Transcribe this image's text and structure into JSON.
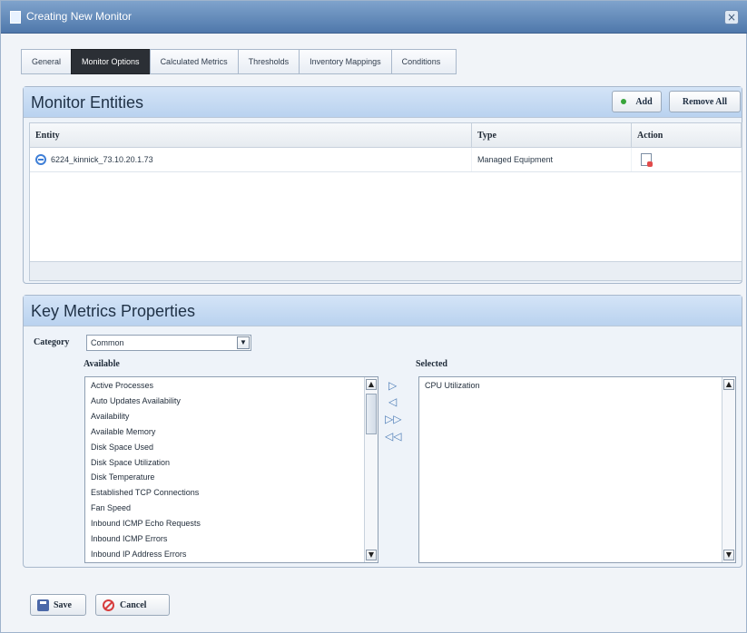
{
  "window": {
    "title": "Creating New Monitor",
    "close_glyph": "×"
  },
  "tabs": [
    "General",
    "Monitor Options",
    "Calculated Metrics",
    "Thresholds",
    "Inventory Mappings",
    "Conditions"
  ],
  "monitor_entities": {
    "title": "Monitor Entities",
    "add_label": "Add",
    "remove_all_label": "Remove All",
    "columns": [
      "Entity",
      "Type",
      "Action"
    ],
    "rows": [
      {
        "entity": "6224_kinnick_73.10.20.1.73",
        "type": "Managed Equipment",
        "action_icon": "document-delete-icon"
      }
    ]
  },
  "key_metrics": {
    "title": "Key Metrics Properties",
    "category_label": "Category",
    "category_value": "Common",
    "available_label": "Available",
    "selected_label": "Selected",
    "available": [
      "Active Processes",
      "Auto Updates Availability",
      "Availability",
      "Available Memory",
      "Disk Space Used",
      "Disk Space Utilization",
      "Disk Temperature",
      "Established TCP Connections",
      "Fan Speed",
      "Inbound ICMP Echo Requests",
      "Inbound ICMP Errors",
      "Inbound IP Address Errors"
    ],
    "selected": [
      "CPU Utilization"
    ]
  },
  "footer": {
    "save_label": "Save",
    "cancel_label": "Cancel"
  },
  "colors": {
    "active_tab": "#2b2f35",
    "header_blue": "#b9d2ef",
    "title_bar": "#4f78ab"
  }
}
